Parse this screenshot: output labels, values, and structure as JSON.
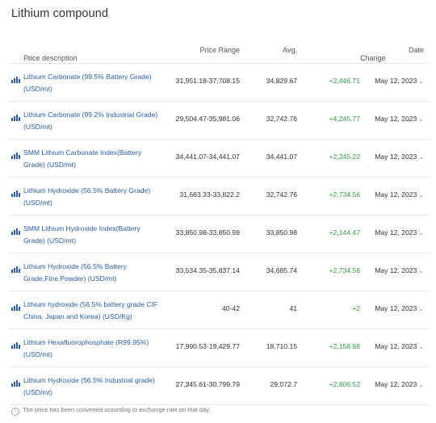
{
  "section": {
    "title": "Lithium compound"
  },
  "table": {
    "headers": {
      "desc": "Price description",
      "range": "Price Range",
      "avg": "Avg.",
      "change": "Change",
      "date": "Date"
    },
    "rows": [
      {
        "desc": "Lithium Carbonate (99.5% Battery Grade) (USD/mt)",
        "range": "31,951.18-37,708.15",
        "avg": "34,829.67",
        "change": "+2,446.71",
        "date": "May 12, 2023"
      },
      {
        "desc": "Lithium Carbonate (99.2% Industrial Grade) (USD/mt)",
        "range": "29,504.47-35,981.06",
        "avg": "32,742.76",
        "change": "+4,245.77",
        "date": "May 12, 2023"
      },
      {
        "desc": "SMM Lithium Carbonate Index(Battery Grade) (USD/mt)",
        "range": "34,441.07-34,441.07",
        "avg": "34,441.07",
        "change": "+2,245.22",
        "date": "May 12, 2023"
      },
      {
        "desc": "Lithium Hydroxide (56.5% Battery Grade) (USD/mt)",
        "range": "31,663.33-33,822.2",
        "avg": "32,742.76",
        "change": "+2,734.56",
        "date": "May 12, 2023"
      },
      {
        "desc": "SMM Lithium Hydroxide Index(Battery Grade) (USD/mt)",
        "range": "33,850.98-33,850.98",
        "avg": "33,850.98",
        "change": "+2,144.47",
        "date": "May 12, 2023"
      },
      {
        "desc": "Lithium Hydroxide (56.5% Battery Grade,Fine Powder) (USD/mt)",
        "range": "33,534.35-35,837.14",
        "avg": "34,685.74",
        "change": "+2,734.56",
        "date": "May 12, 2023"
      },
      {
        "desc": "Lithium hydroxide (56.5% battery grade CIF China, Japan and Korea) (USD/Kg)",
        "range": "40-42",
        "avg": "41",
        "change": "+2",
        "date": "May 12, 2023"
      },
      {
        "desc": "Lithium Hexafluorophosphate (R99.95%) (USD/mt)",
        "range": "17,990.53-19,429.77",
        "avg": "18,710.15",
        "change": "+2,158.86",
        "date": "May 12, 2023"
      },
      {
        "desc": "Lithium Hydroxide (56.5% Industrial grade) (USD/mt)",
        "range": "27,345.61-30,799.79",
        "avg": "29,072.7",
        "change": "+2,806.52",
        "date": "May 12, 2023"
      }
    ]
  },
  "footnote": "The price has been converted according to exchange rate on that day.",
  "icons": {
    "row": "bar-chart-icon",
    "info": "info-icon",
    "sort": "sort-down-icon",
    "date_dropdown": "chevron-down-icon"
  },
  "colors": {
    "link": "#2a5db0",
    "positive": "#2f9e44",
    "divider": "#e8e8e8",
    "icon": "#2a5db0"
  }
}
